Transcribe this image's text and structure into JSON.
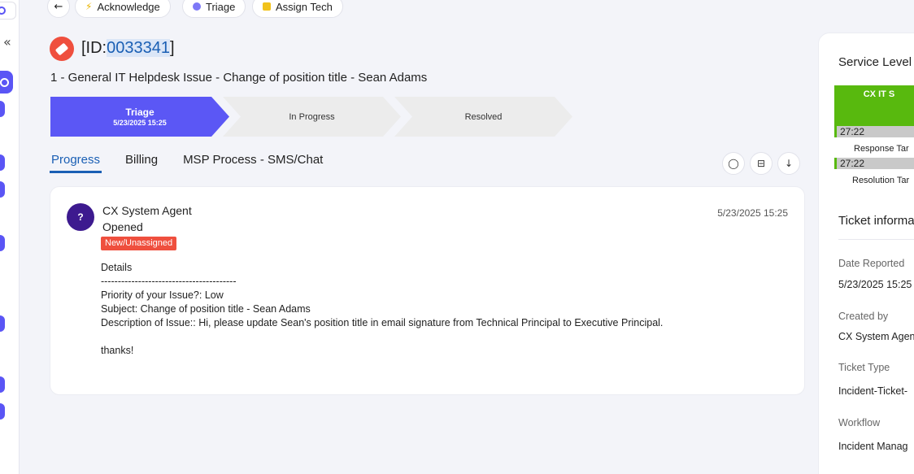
{
  "toolbar": {
    "back_icon": "arrow-left-icon",
    "acknowledge_label": "Acknowledge",
    "triage_label": "Triage",
    "assign_label": "Assign Tech"
  },
  "sidebar": {
    "collapse_glyph": "«"
  },
  "colors": {
    "accent": "#5b57f5",
    "danger": "#ef4f3e",
    "link": "#1a5fb4",
    "sla_green": "#58b90e",
    "avatar": "#3d1a8f"
  },
  "ticket": {
    "id_prefix": "[ID:",
    "id_number": "0033341",
    "id_suffix": "]",
    "title": "1 - General IT Helpdesk Issue - Change of position title - Sean Adams"
  },
  "stepper": {
    "steps": [
      {
        "name": "Triage",
        "date": "5/23/2025 15:25"
      },
      {
        "name": "In Progress"
      },
      {
        "name": "Resolved"
      }
    ]
  },
  "tabs": [
    {
      "label": "Progress"
    },
    {
      "label": "Billing"
    },
    {
      "label": "MSP Process - SMS/Chat"
    }
  ],
  "activity": {
    "avatar_text": "?",
    "agent": "CX System Agent",
    "action": "Opened",
    "badge": "New/Unassigned",
    "timestamp": "5/23/2025 15:25",
    "details": "Details\n----------------------------------------\nPriority of your Issue?: Low\nSubject: Change of position title - Sean Adams\nDescription of Issue:: Hi, please update Sean's position title in email signature from Technical Principal to Executive Principal.\n\nthanks!"
  },
  "right_panel": {
    "service_level_title": "Service Level",
    "sla_name": "CX IT S",
    "response_time": "27:22",
    "response_label": "Response Tar",
    "resolution_time": "27:22",
    "resolution_label": "Resolution Tar",
    "info_title": "Ticket informa",
    "fields": [
      {
        "label": "Date Reported",
        "value": "5/23/2025 15:25"
      },
      {
        "label": "Created by",
        "value": "CX System Agen"
      },
      {
        "label": "Ticket Type",
        "value": "Incident-Ticket-"
      },
      {
        "label": "Workflow",
        "value": "Incident Manag"
      }
    ]
  }
}
